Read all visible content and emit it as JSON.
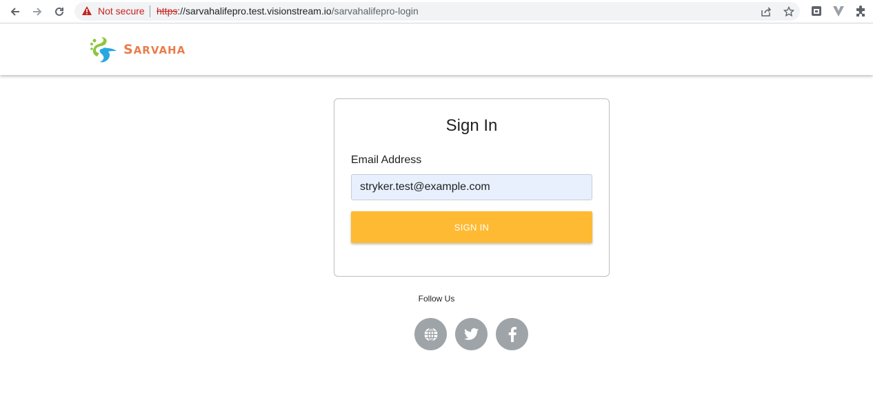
{
  "browser": {
    "security_label": "Not secure",
    "url_scheme": "https",
    "url_host": "://sarvahalifepro.test.visionstream.io",
    "url_path": "/sarvahalifepro-login"
  },
  "header": {
    "logo_text_first": "S",
    "logo_text_rest": "ARVAHA",
    "logo_colors": {
      "text": "#e97d4a",
      "green": "#8dc63f",
      "blue": "#29a8e0"
    }
  },
  "signin": {
    "title": "Sign In",
    "email_label": "Email Address",
    "email_value": "stryker.test@example.com",
    "button_label": "SIGN IN",
    "button_color": "#ffba33"
  },
  "footer": {
    "follow_label": "Follow Us",
    "social": [
      {
        "icon": "globe-icon"
      },
      {
        "icon": "twitter-icon"
      },
      {
        "icon": "facebook-icon"
      }
    ]
  }
}
